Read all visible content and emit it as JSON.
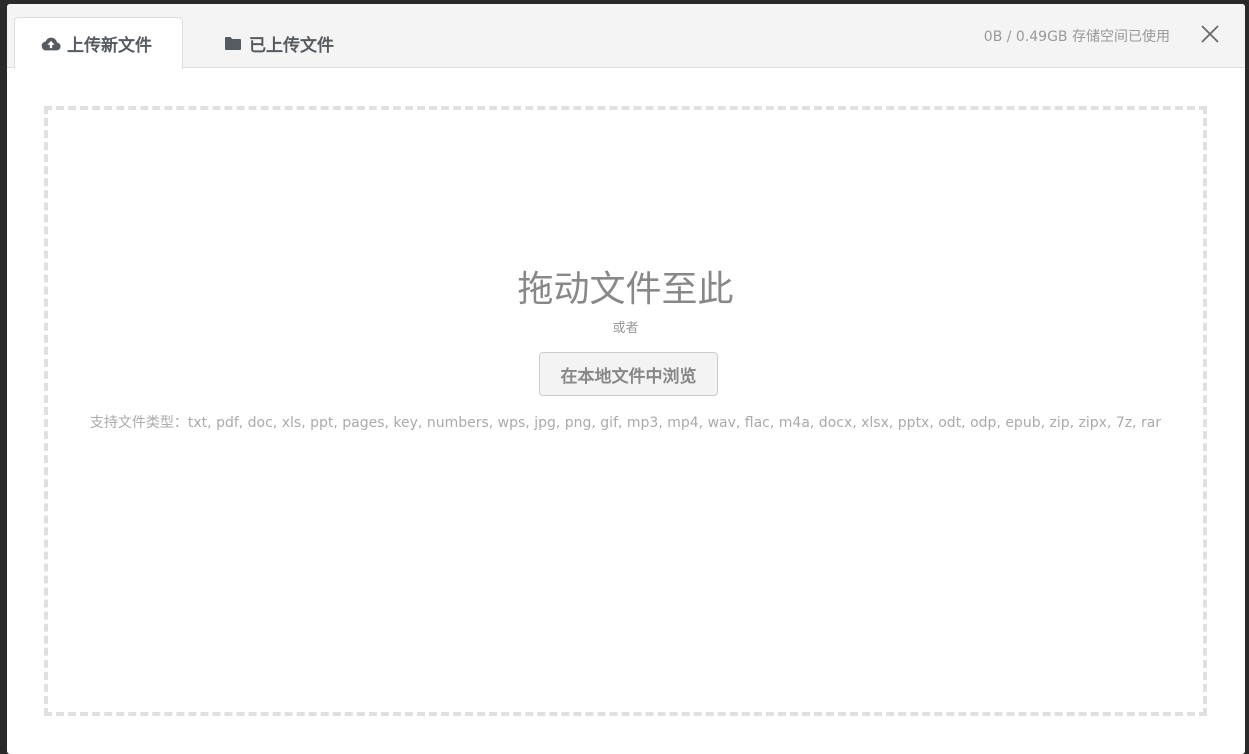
{
  "tabs": [
    {
      "label": "上传新文件",
      "icon": "cloud-upload-icon",
      "active": true
    },
    {
      "label": "已上传文件",
      "icon": "folder-icon",
      "active": false
    }
  ],
  "storage": {
    "text": "0B / 0.49GB 存储空间已使用"
  },
  "dropzone": {
    "title": "拖动文件至此",
    "or_text": "或者",
    "browse_label": "在本地文件中浏览",
    "types_label": "支持文件类型：",
    "types_list": "txt, pdf, doc, xls, ppt, pages, key, numbers, wps, jpg, png, gif, mp3, mp4, wav, flac, m4a, docx, xlsx, pptx, odt, odp, epub, zip, zipx, 7z, rar"
  },
  "colors": {
    "tab_text": "#555b61",
    "muted_text": "#999999",
    "dashed_border": "#e0e0e0"
  }
}
